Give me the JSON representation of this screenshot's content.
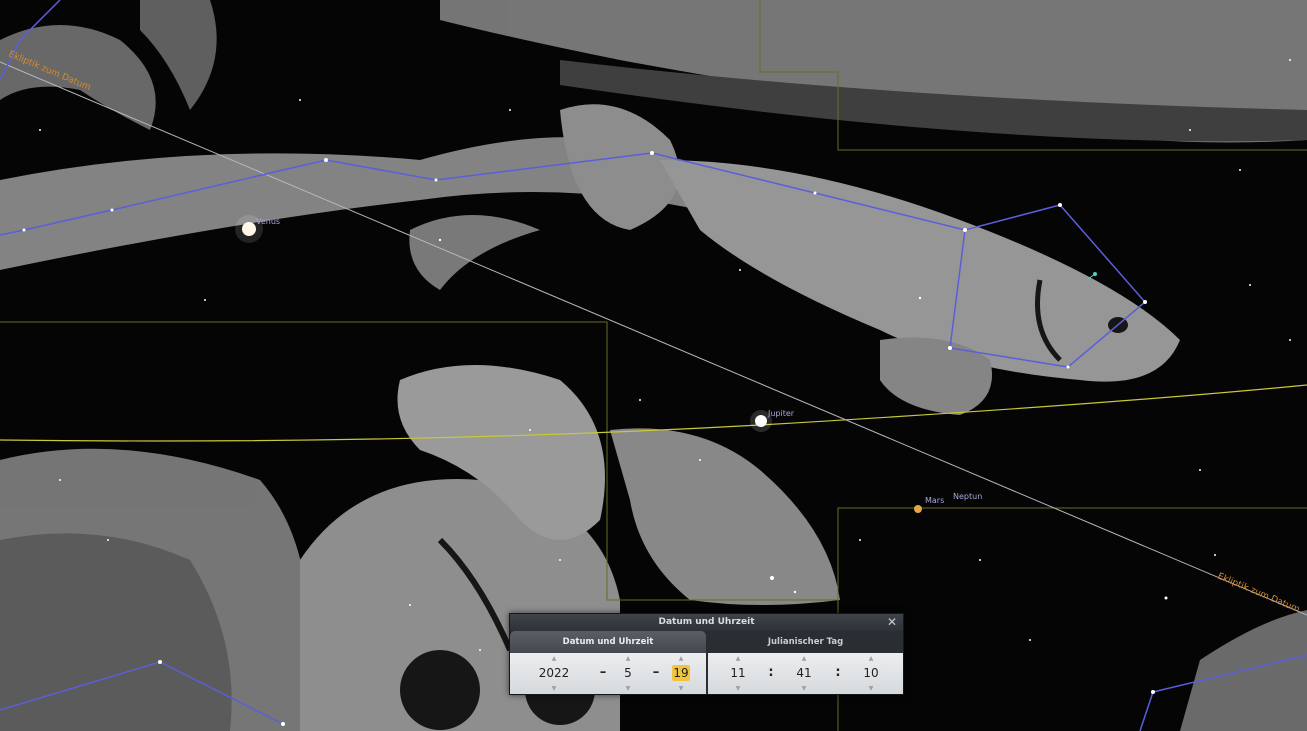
{
  "sky": {
    "ecliptic_label": "Ekliptik zum Datum",
    "planets": {
      "venus": "Venus",
      "jupiter": "Jupiter",
      "mars": "Mars",
      "neptune": "Neptun"
    },
    "colors": {
      "background": "#050505",
      "constellation_art": "#bdbdbd",
      "constellation_lines": "#5a5fd9",
      "ecliptic_line": "#b7b7c4",
      "equator_line": "#c8c83a",
      "boundaries": "#6b6b28",
      "label_orange": "#d48a2e",
      "planet_label": "#a8a8d8"
    }
  },
  "dialog": {
    "title": "Datum und Uhrzeit",
    "close_icon": "close-icon",
    "tabs": [
      {
        "label": "Datum und Uhrzeit",
        "active": true
      },
      {
        "label": "Julianischer Tag",
        "active": false
      }
    ],
    "date": {
      "year": "2022",
      "month": "5",
      "day": "19"
    },
    "time": {
      "hour": "11",
      "minute": "41",
      "second": "10"
    },
    "separators": {
      "date": "–",
      "time": ":"
    }
  }
}
